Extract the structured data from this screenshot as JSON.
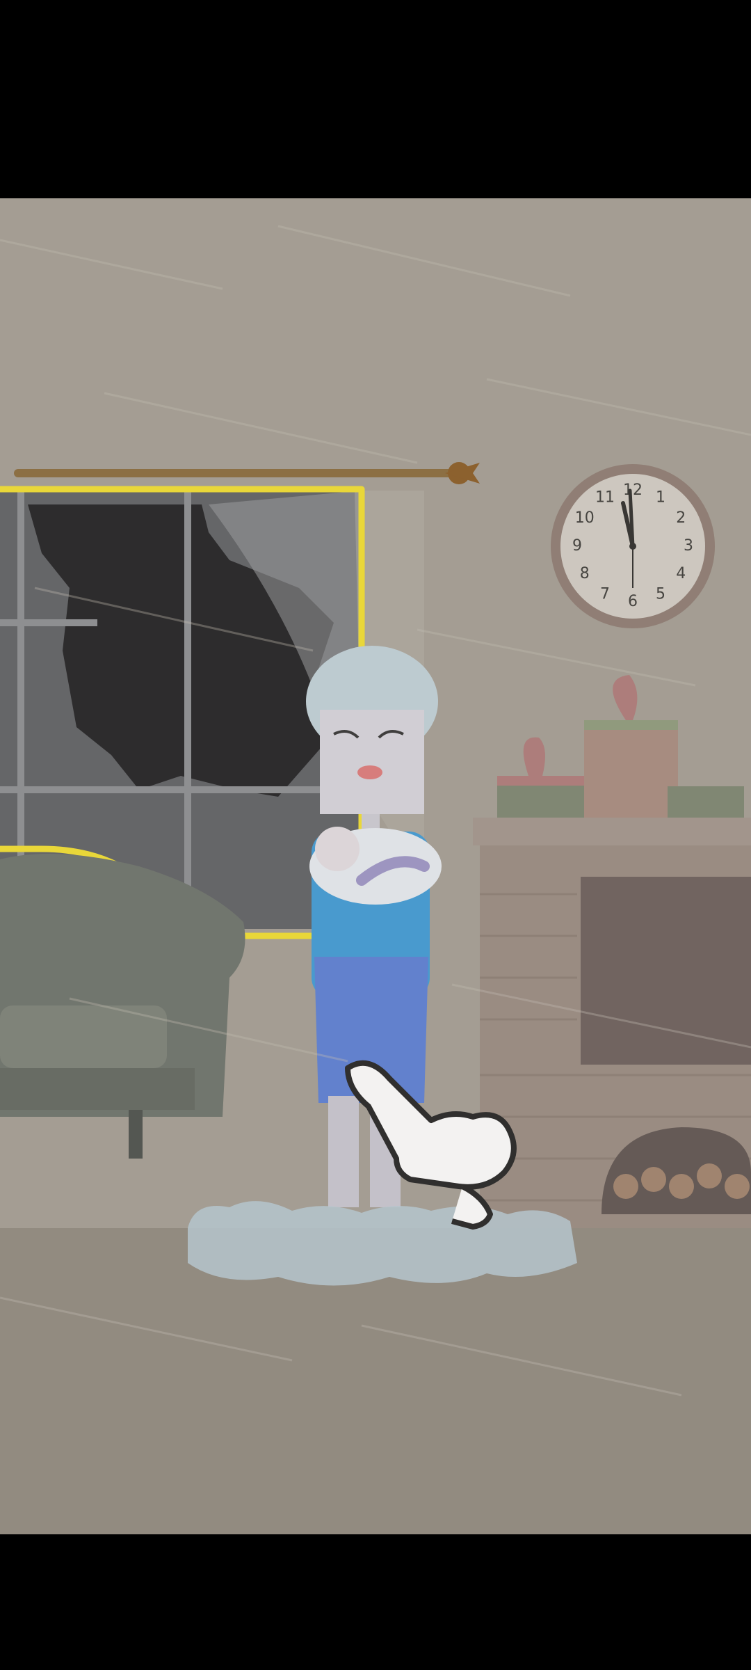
{
  "game": {
    "scene": "storm-living-room",
    "highlight_color": "#f4e12e",
    "storm_tint": "#9e978c",
    "hint": "tap-hand-pointer"
  },
  "clock": {
    "numbers": [
      "12",
      "1",
      "2",
      "3",
      "4",
      "5",
      "6",
      "7",
      "8",
      "9",
      "10",
      "11"
    ]
  },
  "colors": {
    "wall": "#a59f94",
    "floor": "#918a7f",
    "dress_top": "#3e9bd8",
    "dress_bottom": "#5b7fd6",
    "frost": "#b8cbd6"
  }
}
